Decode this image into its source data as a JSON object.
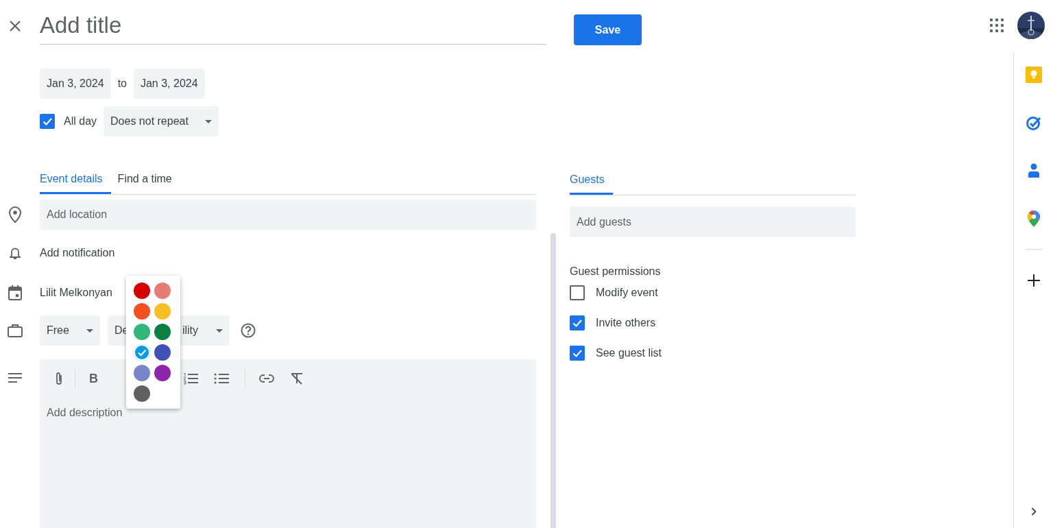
{
  "header": {
    "title_placeholder": "Add title",
    "save_button": "Save"
  },
  "dates": {
    "start": "Jan 3, 2024",
    "separator": "to",
    "end": "Jan 3, 2024"
  },
  "all_day": {
    "label": "All day",
    "checked": true
  },
  "repeat": {
    "value": "Does not repeat"
  },
  "tabs": [
    {
      "label": "Event details",
      "selected": true
    },
    {
      "label": "Find a time",
      "selected": false
    }
  ],
  "location": {
    "placeholder": "Add location"
  },
  "notification": {
    "label": "Add notification"
  },
  "calendar": {
    "owner": "Lilit Melkonyan"
  },
  "availability": {
    "value": "Free"
  },
  "visibility": {
    "value_start": "De",
    "value_end": "ility"
  },
  "description": {
    "bold_button": "B",
    "placeholder": "Add description"
  },
  "color_picker": {
    "colors": [
      {
        "color": "#d50000",
        "selected": false
      },
      {
        "color": "#e67c73",
        "selected": false
      },
      {
        "color": "#f4511e",
        "selected": false
      },
      {
        "color": "#f6bf26",
        "selected": false
      },
      {
        "color": "#33b679",
        "selected": false
      },
      {
        "color": "#0b8043",
        "selected": false
      },
      {
        "color": "#039be5",
        "selected": true
      },
      {
        "color": "#3f51b5",
        "selected": false
      },
      {
        "color": "#7986cb",
        "selected": false
      },
      {
        "color": "#8e24aa",
        "selected": false
      },
      {
        "color": "#616161",
        "selected": false
      }
    ]
  },
  "guests": {
    "tab": {
      "label": "Guests",
      "selected": true
    },
    "placeholder": "Add guests",
    "permissions_title": "Guest permissions",
    "permissions": [
      {
        "label": "Modify event",
        "checked": false
      },
      {
        "label": "Invite others",
        "checked": true
      },
      {
        "label": "See guest list",
        "checked": true
      }
    ]
  }
}
